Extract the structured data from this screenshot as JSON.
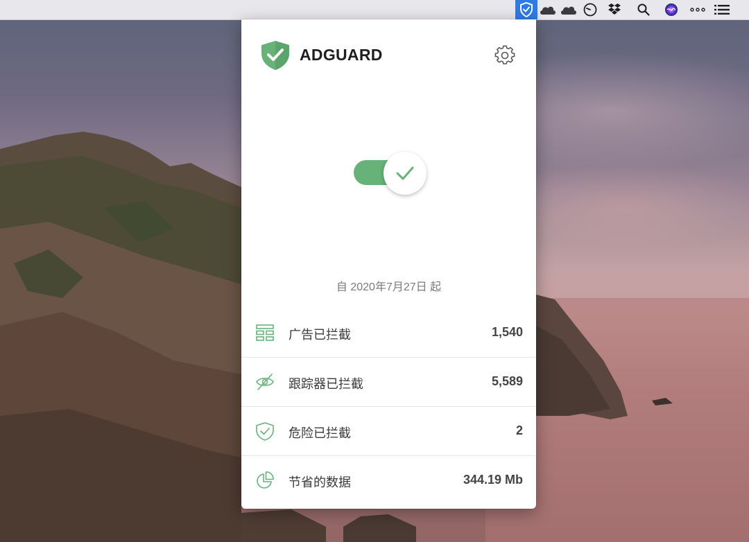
{
  "app": {
    "brand": "ADGUARD",
    "protection_enabled": true,
    "since_text": "自 2020年7月27日 起",
    "accent_color": "#67b279"
  },
  "menubar": {
    "icons": [
      "adguard-shield-icon",
      "cloud-icon",
      "cloud-icon",
      "clock-icon",
      "dropbox-icon",
      "search-icon",
      "siri-icon",
      "more-icon",
      "list-icon"
    ]
  },
  "stats": [
    {
      "icon": "ads-icon",
      "label": "广告已拦截",
      "value": "1,540"
    },
    {
      "icon": "tracker-eye-icon",
      "label": "跟踪器已拦截",
      "value": "5,589"
    },
    {
      "icon": "shield-check-icon",
      "label": "危险已拦截",
      "value": "2"
    },
    {
      "icon": "pie-chart-icon",
      "label": "节省的数据",
      "value": "344.19 Mb"
    }
  ]
}
